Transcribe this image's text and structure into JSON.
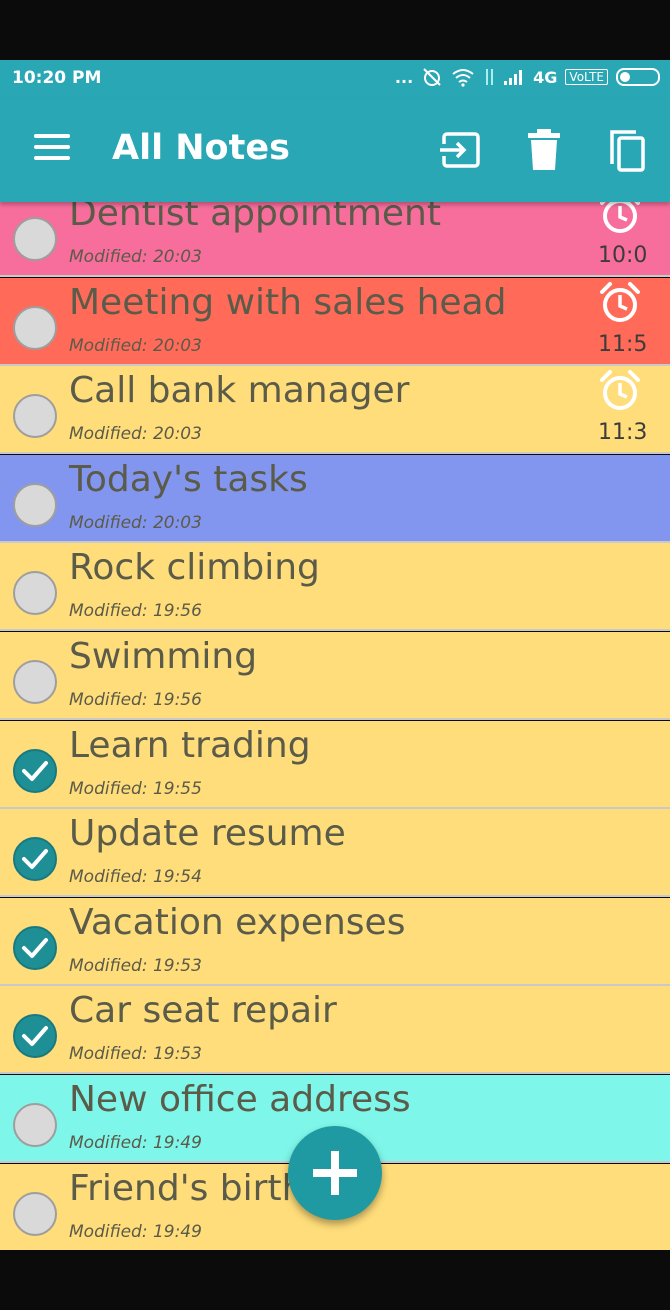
{
  "status_bar": {
    "time": "10:20 PM",
    "dots": "...",
    "network": "4G",
    "volte": "VoLTE"
  },
  "app_bar": {
    "title": "All Notes",
    "menu_icon": "hamburger-menu-icon",
    "actions": [
      "export-icon",
      "trash-icon",
      "copy-icon"
    ]
  },
  "colors": {
    "accent": "#2aa7b4",
    "fab": "#1f9aa3",
    "pink": "#f76d9b",
    "red": "#ff6b58",
    "yellow": "#ffdd7a",
    "blue": "#8396ef",
    "cyan": "#7ff6ea"
  },
  "notes": [
    {
      "title": "Dentist appointment",
      "modified": "Modified: 20:03",
      "color": "#f76d9b",
      "alarm": "10:0",
      "checked": false
    },
    {
      "title": "Meeting with sales head",
      "modified": "Modified: 20:03",
      "color": "#ff6b58",
      "alarm": "11:5",
      "checked": false
    },
    {
      "title": "Call bank manager",
      "modified": "Modified: 20:03",
      "color": "#ffdd7a",
      "alarm": "11:3",
      "checked": false
    },
    {
      "title": "Today's tasks",
      "modified": "Modified: 20:03",
      "color": "#8396ef",
      "alarm": "",
      "checked": false
    },
    {
      "title": "Rock climbing",
      "modified": "Modified: 19:56",
      "color": "#ffdd7a",
      "alarm": "",
      "checked": false
    },
    {
      "title": "Swimming",
      "modified": "Modified: 19:56",
      "color": "#ffdd7a",
      "alarm": "",
      "checked": false
    },
    {
      "title": "Learn trading",
      "modified": "Modified: 19:55",
      "color": "#ffdd7a",
      "alarm": "",
      "checked": true
    },
    {
      "title": "Update resume",
      "modified": "Modified: 19:54",
      "color": "#ffdd7a",
      "alarm": "",
      "checked": true
    },
    {
      "title": "Vacation expenses",
      "modified": "Modified: 19:53",
      "color": "#ffdd7a",
      "alarm": "",
      "checked": true
    },
    {
      "title": "Car seat repair",
      "modified": "Modified: 19:53",
      "color": "#ffdd7a",
      "alarm": "",
      "checked": true
    },
    {
      "title": "New office address",
      "modified": "Modified: 19:49",
      "color": "#7ff6ea",
      "alarm": "",
      "checked": false
    },
    {
      "title": "Friend's birthd",
      "modified": "Modified: 19:49",
      "color": "#ffdd7a",
      "alarm": "",
      "checked": false
    }
  ],
  "fab": {
    "icon": "plus-icon"
  }
}
